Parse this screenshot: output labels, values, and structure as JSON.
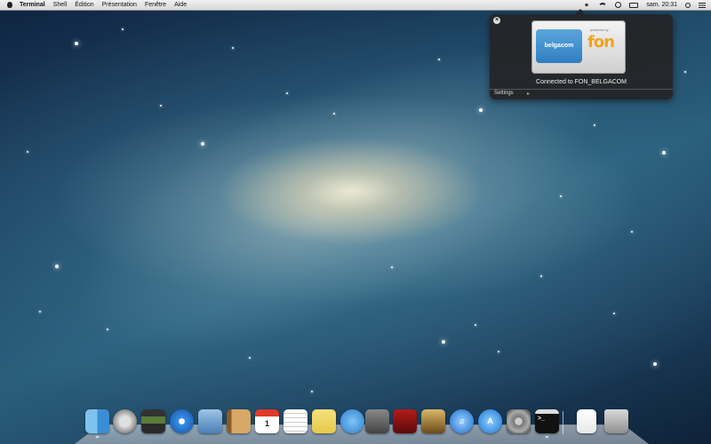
{
  "menubar": {
    "app_name": "Terminal",
    "items": [
      "Shell",
      "Édition",
      "Présentation",
      "Fenêtre",
      "Aide"
    ],
    "clock": "sam. 20:31",
    "status_icons": [
      "fon-icon",
      "wifi-icon",
      "time-machine-icon",
      "battery-icon",
      "spotlight-search-icon",
      "notification-center-icon"
    ]
  },
  "hud": {
    "close_label": "×",
    "belgacom_label": "belgacom",
    "powered_by": "powered by",
    "fon_label": "fon",
    "status": "Connected to FON_BELGACOM",
    "settings_label": "Settings",
    "settings_arrow": "▸"
  },
  "dock": {
    "apps": [
      {
        "name": "Finder",
        "icon": "finder-icon",
        "running": true
      },
      {
        "name": "Launchpad",
        "icon": "launchpad-icon",
        "running": false
      },
      {
        "name": "Mission Control",
        "icon": "mission-control-icon",
        "running": false
      },
      {
        "name": "Safari",
        "icon": "safari-icon",
        "running": false
      },
      {
        "name": "Mail",
        "icon": "mail-icon",
        "running": false
      },
      {
        "name": "Contacts",
        "icon": "contacts-icon",
        "running": false
      },
      {
        "name": "Calendar",
        "icon": "calendar-icon",
        "label": "1",
        "running": false
      },
      {
        "name": "Reminders",
        "icon": "reminders-icon",
        "running": false
      },
      {
        "name": "Notes",
        "icon": "notes-icon",
        "running": false
      },
      {
        "name": "Messages",
        "icon": "messages-icon",
        "running": false
      },
      {
        "name": "FaceTime",
        "icon": "facetime-icon",
        "running": false
      },
      {
        "name": "Photo Booth",
        "icon": "photo-booth-icon",
        "running": false
      },
      {
        "name": "iPhoto",
        "icon": "iphoto-icon",
        "running": false
      },
      {
        "name": "iTunes",
        "icon": "itunes-icon",
        "label": "♫",
        "running": false
      },
      {
        "name": "App Store",
        "icon": "app-store-icon",
        "label": "A",
        "running": false
      },
      {
        "name": "System Preferences",
        "icon": "system-preferences-icon",
        "running": false
      },
      {
        "name": "Terminal",
        "icon": "terminal-icon",
        "label": ">_",
        "running": true
      }
    ],
    "right": [
      {
        "name": "Document",
        "icon": "document-icon"
      },
      {
        "name": "Trash",
        "icon": "trash-icon"
      }
    ]
  }
}
